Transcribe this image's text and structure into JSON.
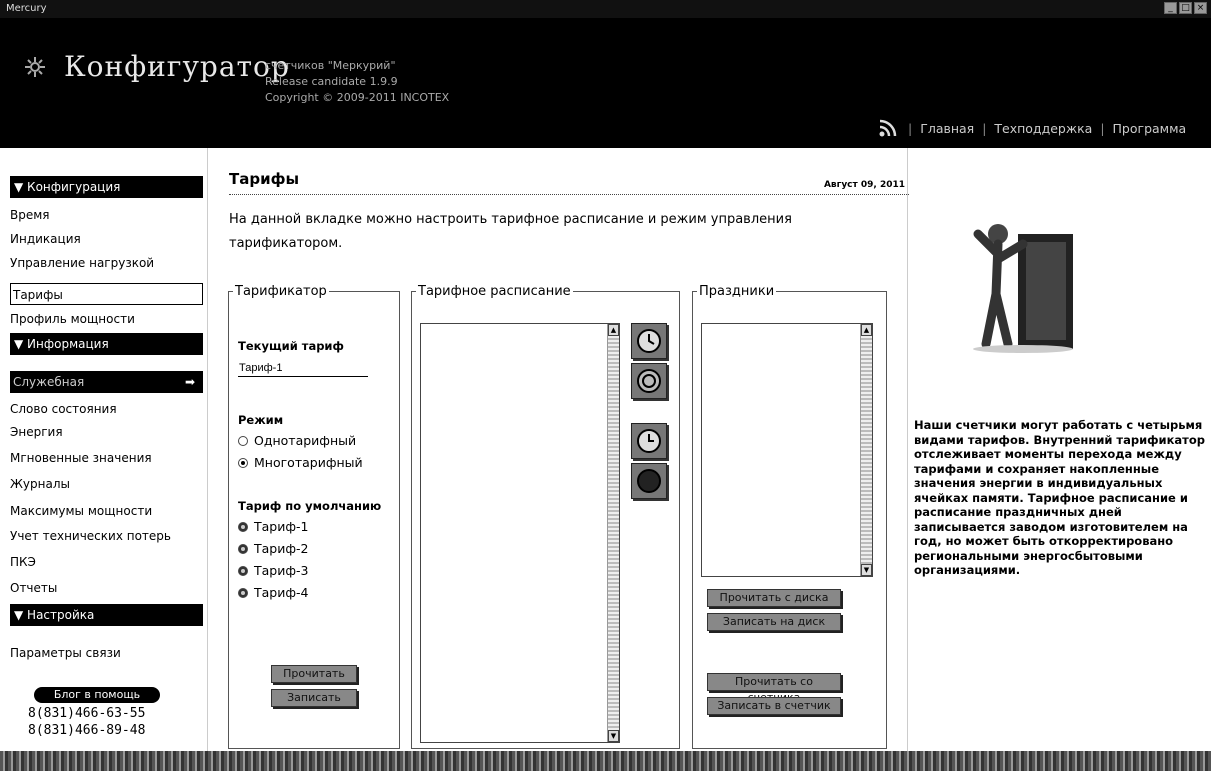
{
  "window": {
    "title": "Mercury"
  },
  "header": {
    "app_title": "Конфигуратор",
    "meta_line1": "счетчиков \"Меркурий\"",
    "meta_line2": "Release candidate 1.9.9",
    "meta_line3": "Copyright © 2009-2011 INCOTEX",
    "nav": [
      "Главная",
      "Техподдержка",
      "Программа"
    ]
  },
  "sidebar": {
    "sections": [
      "▼ Конфигурация",
      "▼ Информация",
      "▼ Настройка"
    ],
    "config_items": [
      "Время",
      "Индикация",
      "Управление нагрузкой",
      "Тарифы",
      "Профиль мощности"
    ],
    "info_items": [
      "Служебная",
      "Слово состояния",
      "Энергия",
      "Мгновенные значения",
      "Журналы",
      "Максимумы мощности",
      "Учет технических потерь",
      "ПКЭ",
      "Отчеты"
    ],
    "settings_items": [
      "Параметры связи"
    ],
    "blog_label": "Блог в помощь",
    "phones": [
      "8(831)466-63-55",
      "8(831)466-89-48"
    ],
    "active_item": "Тарифы",
    "highlight_item": "Служебная"
  },
  "main": {
    "title": "Тарифы",
    "date": "Август 09, 2011",
    "description": "На данной вкладке можно настроить тарифное расписание и режим управления тарификатором.",
    "tariff_panel": {
      "legend": "Тарификатор",
      "current_label": "Текущий тариф",
      "current_value": "Тариф-1",
      "mode_label": "Режим",
      "modes": [
        "Однотарифный",
        "Многотарифный"
      ],
      "selected_mode": "Многотарифный",
      "default_label": "Тариф по умолчанию",
      "default_options": [
        "Тариф-1",
        "Тариф-2",
        "Тариф-3",
        "Тариф-4"
      ],
      "read_button": "Прочитать",
      "write_button": "Записать"
    },
    "schedule_panel": {
      "legend": "Тарифное расписание"
    },
    "holidays_panel": {
      "legend": "Праздники",
      "buttons": [
        "Прочитать с диска",
        "Записать на диск",
        "Прочитать со счетчика",
        "Записать в счетчик"
      ]
    }
  },
  "right": {
    "info_bold": "Наши",
    "info_text": " счетчики могут работать с четырьмя видами тарифов. Внутренний тарификатор отслеживает моменты перехода между тарифами и сохраняет накопленные значения энергии в индивидуальных ячейках памяти. Тарифное расписание и расписание праздничных дней записывается заводом изготовителем на год, но может быть откорректировано региональными энергосбытовыми организациями."
  },
  "icons": [
    "logo-icon",
    "rss-icon",
    "clock-icon",
    "figure-illustration"
  ]
}
